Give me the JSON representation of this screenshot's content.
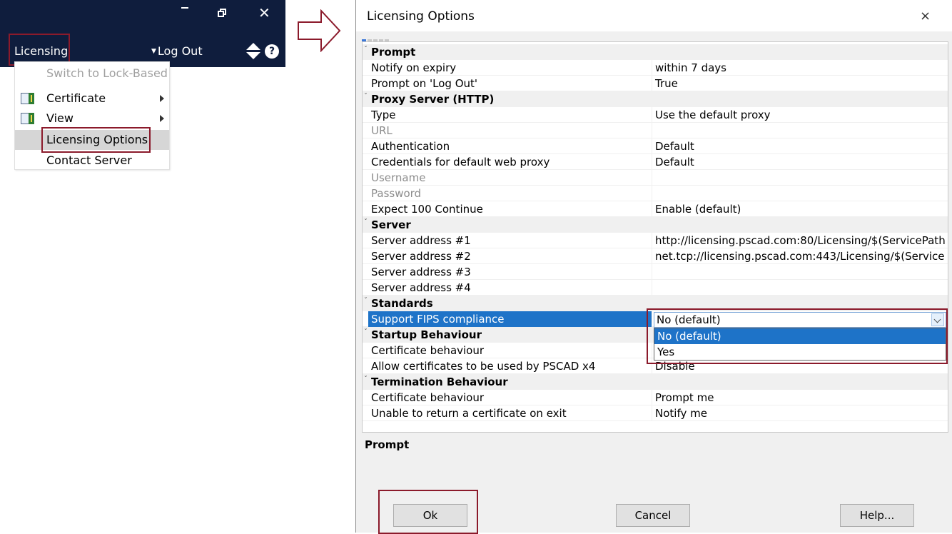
{
  "app": {
    "menu_label": "Licensing",
    "logout_label": "Log Out",
    "help_glyph": "?",
    "close_glyph": "✕"
  },
  "menu": {
    "items": [
      {
        "label": "Switch to Lock-Based",
        "disabled": true
      },
      {
        "label": "Certificate",
        "icon": "grid-icon",
        "submenu": true
      },
      {
        "label": "View",
        "icon": "grid-icon",
        "submenu": true
      },
      {
        "label": "Licensing Options",
        "selected": true
      },
      {
        "label": "Contact Server"
      }
    ]
  },
  "dialog": {
    "title": "Licensing Options",
    "close_glyph": "×",
    "categories": [
      {
        "name": "Prompt",
        "rows": [
          {
            "label": "Notify on expiry",
            "value": "within 7 days"
          },
          {
            "label": "Prompt on 'Log Out'",
            "value": "True"
          }
        ]
      },
      {
        "name": "Proxy Server (HTTP)",
        "rows": [
          {
            "label": "Type",
            "value": "Use the default proxy"
          },
          {
            "label": "URL",
            "value": "",
            "disabled": true
          },
          {
            "label": "Authentication",
            "value": "Default"
          },
          {
            "label": "Credentials for default web proxy",
            "value": "Default"
          },
          {
            "label": "Username",
            "value": "",
            "disabled": true
          },
          {
            "label": "Password",
            "value": "",
            "disabled": true
          },
          {
            "label": "Expect 100 Continue",
            "value": "Enable (default)"
          }
        ]
      },
      {
        "name": "Server",
        "rows": [
          {
            "label": "Server address #1",
            "value": "http://licensing.pscad.com:80/Licensing/$(ServicePath"
          },
          {
            "label": "Server address #2",
            "value": "net.tcp://licensing.pscad.com:443/Licensing/$(Service"
          },
          {
            "label": "Server address #3",
            "value": ""
          },
          {
            "label": "Server address #4",
            "value": ""
          }
        ]
      },
      {
        "name": "Standards",
        "rows": [
          {
            "label": "Support FIPS compliance",
            "value": "No (default)",
            "active": true
          }
        ]
      },
      {
        "name": "Startup Behaviour",
        "rows": [
          {
            "label": "Certificate behaviour",
            "value": ""
          },
          {
            "label": "Allow certificates to be used by PSCAD x4",
            "value": "Disable"
          }
        ]
      },
      {
        "name": "Termination Behaviour",
        "rows": [
          {
            "label": "Certificate behaviour",
            "value": "Prompt me"
          },
          {
            "label": "Unable to return a certificate on exit",
            "value": "Notify me"
          }
        ]
      }
    ],
    "combo": {
      "value": "No (default)",
      "options": [
        "No (default)",
        "Yes"
      ],
      "highlighted": "No (default)"
    },
    "description_title": "Prompt",
    "buttons": {
      "ok": "Ok",
      "cancel": "Cancel",
      "help": "Help..."
    }
  },
  "colors": {
    "app_bar": "#0f1d3d",
    "highlight_box": "#8b1a2b",
    "selection": "#1e73c8"
  }
}
